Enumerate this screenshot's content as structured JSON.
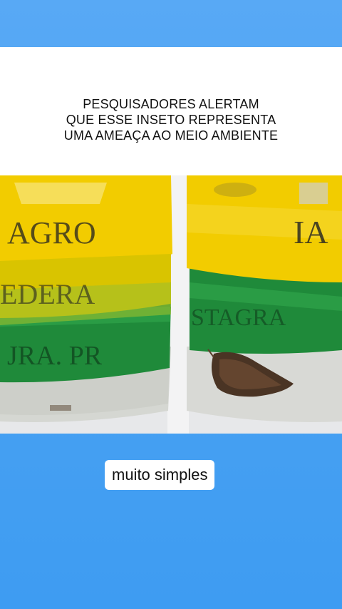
{
  "headline": {
    "lines": [
      "PESQUISADORES ALERTAM",
      "QUE ESSE INSETO REPRESENTA",
      "UMA AMEAÇA AO MEIO AMBIENTE"
    ]
  },
  "photo": {
    "icon": "video-frame-two-jars-icon"
  },
  "caption": {
    "text": "muito simples"
  },
  "colors": {
    "background": "#4ca3f3",
    "tape_yellow": "#f2cc00",
    "tape_green": "#1f8a3a",
    "caption_bg": "#ffffff"
  }
}
